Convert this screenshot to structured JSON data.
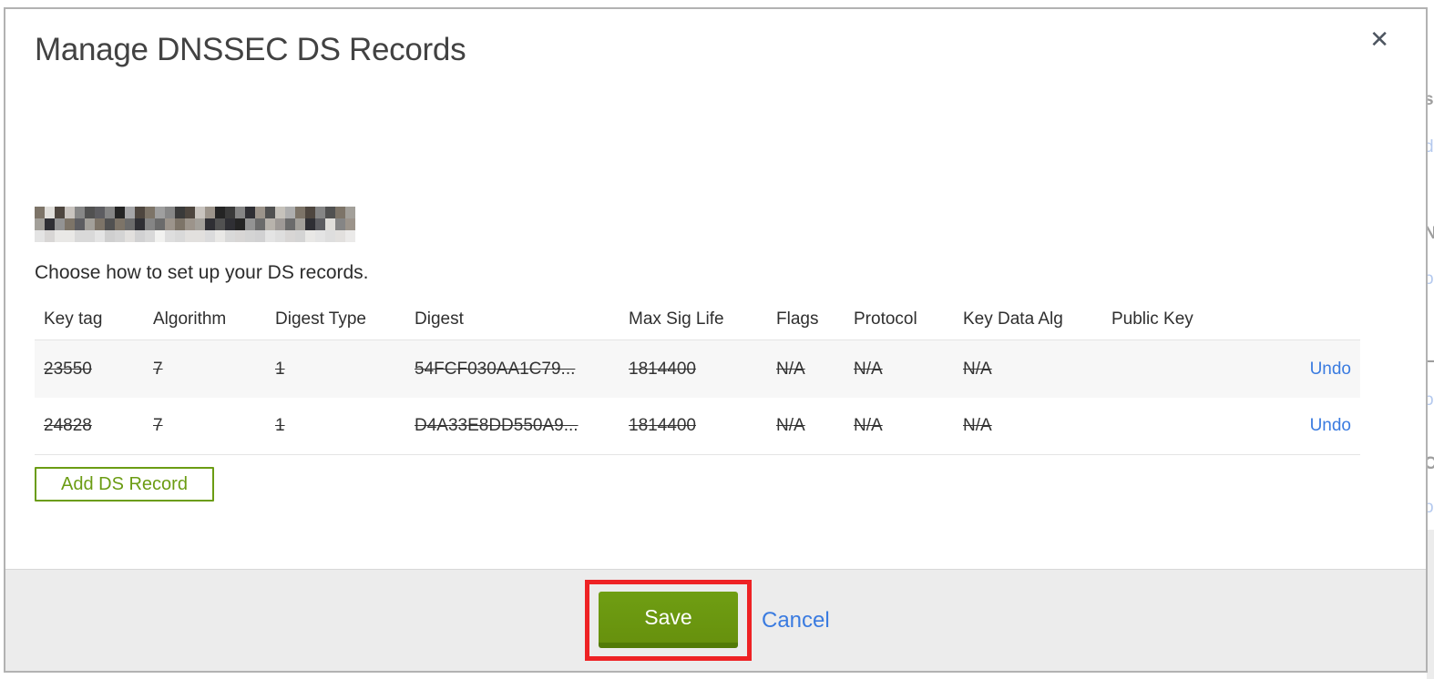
{
  "modal": {
    "title": "Manage DNSSEC DS Records",
    "close_label": "✕",
    "domain": {
      "redacted": true
    },
    "instruction": "Choose how to set up your DS records.",
    "table": {
      "columns": [
        "Key tag",
        "Algorithm",
        "Digest Type",
        "Digest",
        "Max Sig Life",
        "Flags",
        "Protocol",
        "Key Data Alg",
        "Public Key"
      ],
      "rows": [
        {
          "cells": [
            "23550",
            "7",
            "1",
            "54FCF030AA1C79...",
            "1814400",
            "N/A",
            "N/A",
            "N/A",
            ""
          ],
          "struck": true,
          "action": "Undo"
        },
        {
          "cells": [
            "24828",
            "7",
            "1",
            "D4A33E8DD550A9...",
            "1814400",
            "N/A",
            "N/A",
            "N/A",
            ""
          ],
          "struck": true,
          "action": "Undo"
        }
      ]
    },
    "add_button_label": "Add DS Record",
    "footer": {
      "save_label": "Save",
      "cancel_label": "Cancel"
    },
    "annotation": {
      "type": "highlight-box",
      "color": "#ee2224",
      "target": "save-button"
    }
  },
  "colors": {
    "accent_green": "#6b9c13",
    "save_green_dark": "#527b07",
    "link_blue": "#3a7be0",
    "annotation_red": "#ee2224",
    "footer_gray": "#ececec"
  },
  "background_page": {
    "edge_fragments": [
      "s",
      "d",
      "N",
      "o",
      "L",
      "o",
      "C",
      "o"
    ]
  }
}
